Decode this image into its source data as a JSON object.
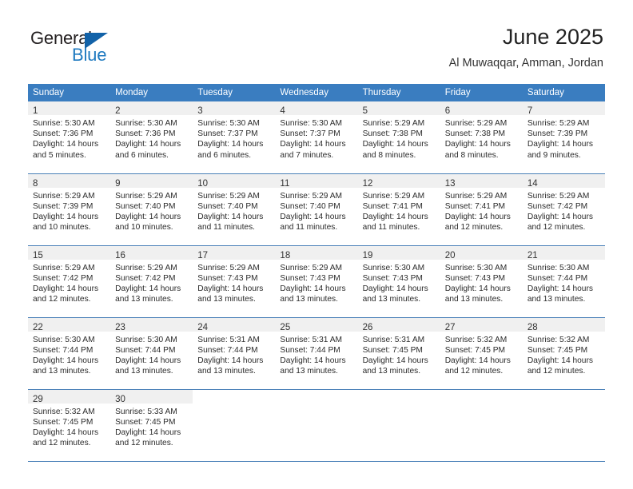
{
  "logo": {
    "word_one": "General",
    "word_two": "Blue",
    "mark": "triangle-mark"
  },
  "header": {
    "title": "June 2025",
    "subtitle": "Al Muwaqqar, Amman, Jordan"
  },
  "colors": {
    "header_blue": "#3a7dc0",
    "grid_line": "#4a80b8",
    "daynum_band": "#f0f0f0",
    "logo_blue": "#1f7ac0",
    "logo_mark_blue": "#1262a8"
  },
  "weekday_headers": [
    "Sunday",
    "Monday",
    "Tuesday",
    "Wednesday",
    "Thursday",
    "Friday",
    "Saturday"
  ],
  "weeks": [
    [
      {
        "day": "1",
        "lines": [
          "Sunrise: 5:30 AM",
          "Sunset: 7:36 PM",
          "Daylight: 14 hours",
          "and 5 minutes."
        ]
      },
      {
        "day": "2",
        "lines": [
          "Sunrise: 5:30 AM",
          "Sunset: 7:36 PM",
          "Daylight: 14 hours",
          "and 6 minutes."
        ]
      },
      {
        "day": "3",
        "lines": [
          "Sunrise: 5:30 AM",
          "Sunset: 7:37 PM",
          "Daylight: 14 hours",
          "and 6 minutes."
        ]
      },
      {
        "day": "4",
        "lines": [
          "Sunrise: 5:30 AM",
          "Sunset: 7:37 PM",
          "Daylight: 14 hours",
          "and 7 minutes."
        ]
      },
      {
        "day": "5",
        "lines": [
          "Sunrise: 5:29 AM",
          "Sunset: 7:38 PM",
          "Daylight: 14 hours",
          "and 8 minutes."
        ]
      },
      {
        "day": "6",
        "lines": [
          "Sunrise: 5:29 AM",
          "Sunset: 7:38 PM",
          "Daylight: 14 hours",
          "and 8 minutes."
        ]
      },
      {
        "day": "7",
        "lines": [
          "Sunrise: 5:29 AM",
          "Sunset: 7:39 PM",
          "Daylight: 14 hours",
          "and 9 minutes."
        ]
      }
    ],
    [
      {
        "day": "8",
        "lines": [
          "Sunrise: 5:29 AM",
          "Sunset: 7:39 PM",
          "Daylight: 14 hours",
          "and 10 minutes."
        ]
      },
      {
        "day": "9",
        "lines": [
          "Sunrise: 5:29 AM",
          "Sunset: 7:40 PM",
          "Daylight: 14 hours",
          "and 10 minutes."
        ]
      },
      {
        "day": "10",
        "lines": [
          "Sunrise: 5:29 AM",
          "Sunset: 7:40 PM",
          "Daylight: 14 hours",
          "and 11 minutes."
        ]
      },
      {
        "day": "11",
        "lines": [
          "Sunrise: 5:29 AM",
          "Sunset: 7:40 PM",
          "Daylight: 14 hours",
          "and 11 minutes."
        ]
      },
      {
        "day": "12",
        "lines": [
          "Sunrise: 5:29 AM",
          "Sunset: 7:41 PM",
          "Daylight: 14 hours",
          "and 11 minutes."
        ]
      },
      {
        "day": "13",
        "lines": [
          "Sunrise: 5:29 AM",
          "Sunset: 7:41 PM",
          "Daylight: 14 hours",
          "and 12 minutes."
        ]
      },
      {
        "day": "14",
        "lines": [
          "Sunrise: 5:29 AM",
          "Sunset: 7:42 PM",
          "Daylight: 14 hours",
          "and 12 minutes."
        ]
      }
    ],
    [
      {
        "day": "15",
        "lines": [
          "Sunrise: 5:29 AM",
          "Sunset: 7:42 PM",
          "Daylight: 14 hours",
          "and 12 minutes."
        ]
      },
      {
        "day": "16",
        "lines": [
          "Sunrise: 5:29 AM",
          "Sunset: 7:42 PM",
          "Daylight: 14 hours",
          "and 13 minutes."
        ]
      },
      {
        "day": "17",
        "lines": [
          "Sunrise: 5:29 AM",
          "Sunset: 7:43 PM",
          "Daylight: 14 hours",
          "and 13 minutes."
        ]
      },
      {
        "day": "18",
        "lines": [
          "Sunrise: 5:29 AM",
          "Sunset: 7:43 PM",
          "Daylight: 14 hours",
          "and 13 minutes."
        ]
      },
      {
        "day": "19",
        "lines": [
          "Sunrise: 5:30 AM",
          "Sunset: 7:43 PM",
          "Daylight: 14 hours",
          "and 13 minutes."
        ]
      },
      {
        "day": "20",
        "lines": [
          "Sunrise: 5:30 AM",
          "Sunset: 7:43 PM",
          "Daylight: 14 hours",
          "and 13 minutes."
        ]
      },
      {
        "day": "21",
        "lines": [
          "Sunrise: 5:30 AM",
          "Sunset: 7:44 PM",
          "Daylight: 14 hours",
          "and 13 minutes."
        ]
      }
    ],
    [
      {
        "day": "22",
        "lines": [
          "Sunrise: 5:30 AM",
          "Sunset: 7:44 PM",
          "Daylight: 14 hours",
          "and 13 minutes."
        ]
      },
      {
        "day": "23",
        "lines": [
          "Sunrise: 5:30 AM",
          "Sunset: 7:44 PM",
          "Daylight: 14 hours",
          "and 13 minutes."
        ]
      },
      {
        "day": "24",
        "lines": [
          "Sunrise: 5:31 AM",
          "Sunset: 7:44 PM",
          "Daylight: 14 hours",
          "and 13 minutes."
        ]
      },
      {
        "day": "25",
        "lines": [
          "Sunrise: 5:31 AM",
          "Sunset: 7:44 PM",
          "Daylight: 14 hours",
          "and 13 minutes."
        ]
      },
      {
        "day": "26",
        "lines": [
          "Sunrise: 5:31 AM",
          "Sunset: 7:45 PM",
          "Daylight: 14 hours",
          "and 13 minutes."
        ]
      },
      {
        "day": "27",
        "lines": [
          "Sunrise: 5:32 AM",
          "Sunset: 7:45 PM",
          "Daylight: 14 hours",
          "and 12 minutes."
        ]
      },
      {
        "day": "28",
        "lines": [
          "Sunrise: 5:32 AM",
          "Sunset: 7:45 PM",
          "Daylight: 14 hours",
          "and 12 minutes."
        ]
      }
    ],
    [
      {
        "day": "29",
        "lines": [
          "Sunrise: 5:32 AM",
          "Sunset: 7:45 PM",
          "Daylight: 14 hours",
          "and 12 minutes."
        ]
      },
      {
        "day": "30",
        "lines": [
          "Sunrise: 5:33 AM",
          "Sunset: 7:45 PM",
          "Daylight: 14 hours",
          "and 12 minutes."
        ]
      },
      {
        "day": "",
        "lines": []
      },
      {
        "day": "",
        "lines": []
      },
      {
        "day": "",
        "lines": []
      },
      {
        "day": "",
        "lines": []
      },
      {
        "day": "",
        "lines": []
      }
    ]
  ]
}
